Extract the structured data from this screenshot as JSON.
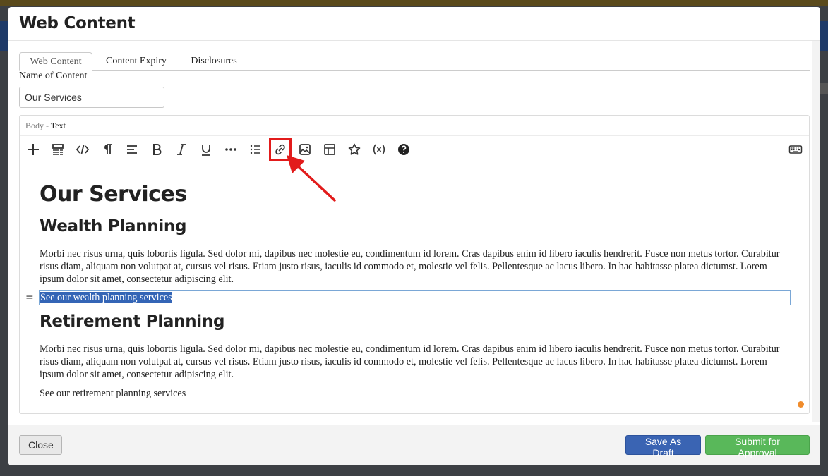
{
  "modal": {
    "title": "Web Content"
  },
  "tabs": [
    {
      "label": "Web Content",
      "active": true
    },
    {
      "label": "Content Expiry",
      "active": false
    },
    {
      "label": "Disclosures",
      "active": false
    }
  ],
  "form": {
    "name_label": "Name of Content",
    "name_value": "Our Services"
  },
  "editor": {
    "label": "Body -",
    "mode": "Text",
    "toolbar": [
      {
        "name": "plus-icon"
      },
      {
        "name": "block-format-icon"
      },
      {
        "name": "source-code-icon"
      },
      {
        "name": "paragraph-icon"
      },
      {
        "name": "align-left-icon"
      },
      {
        "name": "bold-icon"
      },
      {
        "name": "italic-icon"
      },
      {
        "name": "underline-icon"
      },
      {
        "name": "more-icon"
      },
      {
        "name": "bulleted-list-icon"
      },
      {
        "name": "link-icon"
      },
      {
        "name": "image-icon"
      },
      {
        "name": "table-icon"
      },
      {
        "name": "star-icon"
      },
      {
        "name": "variable-icon"
      },
      {
        "name": "help-icon"
      },
      {
        "name": "keyboard-icon"
      }
    ],
    "content": {
      "h1": "Our Services",
      "section1_title": "Wealth Planning",
      "section1_body": "Morbi nec risus urna, quis lobortis ligula. Sed dolor mi, dapibus nec molestie eu, condimentum id lorem. Cras dapibus enim id libero iaculis hendrerit. Fusce non metus tortor. Curabitur risus diam, aliquam non volutpat at, cursus vel risus. Etiam justo risus, iaculis id commodo et, molestie vel felis. Pellentesque ac lacus libero. In hac habitasse platea dictumst. Lorem ipsum dolor sit amet, consectetur adipiscing elit.",
      "section1_link": "See our wealth planning services",
      "drag_handle": "=",
      "section2_title": "Retirement Planning",
      "section2_body": "Morbi nec risus urna, quis lobortis ligula. Sed dolor mi, dapibus nec molestie eu, condimentum id lorem. Cras dapibus enim id libero iaculis hendrerit. Fusce non metus tortor. Curabitur risus diam, aliquam non volutpat at, cursus vel risus. Etiam justo risus, iaculis id commodo et, molestie vel felis. Pellentesque ac lacus libero. In hac habitasse platea dictumst. Lorem ipsum dolor sit amet, consectetur adipiscing elit.",
      "section2_link": "See our retirement planning services"
    }
  },
  "footer": {
    "close_label": "Close",
    "draft_label": "Save As Draft",
    "submit_label": "Submit for Approval"
  },
  "colors": {
    "primary": "#3a64b3",
    "success": "#59b85a",
    "annotation": "#e21b1b",
    "selection": "#3465b6"
  }
}
